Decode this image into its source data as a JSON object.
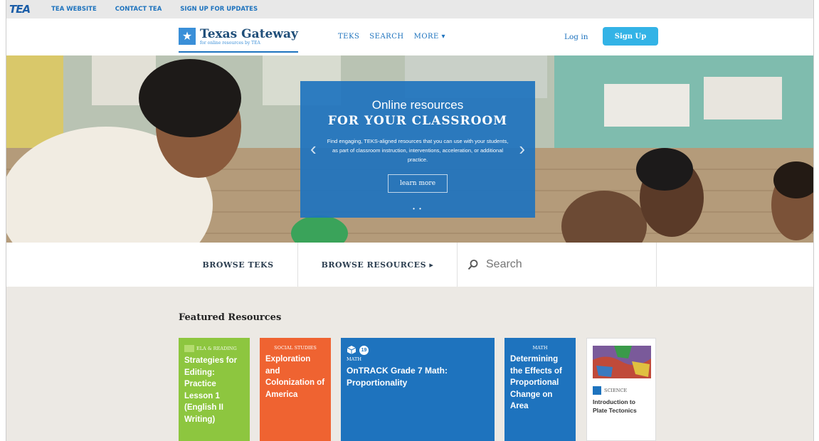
{
  "utility_bar": {
    "logo": "TEA",
    "links": [
      "TEA WEBSITE",
      "CONTACT TEA",
      "SIGN UP FOR UPDATES"
    ]
  },
  "header": {
    "brand_title": "Texas Gateway",
    "brand_subtitle": "for online resources by TEA",
    "nav": [
      "TEKS",
      "SEARCH",
      "MORE ▾"
    ],
    "login": "Log in",
    "signup": "Sign Up"
  },
  "hero": {
    "title_line1": "Online resources",
    "title_line2": "FOR YOUR CLASSROOM",
    "description": "Find engaging, TEKS-aligned resources that you can use with your students, as part of classroom instruction, interventions, acceleration, or additional practice.",
    "button": "learn more",
    "prev_arrow": "‹",
    "next_arrow": "›",
    "dots": "• •"
  },
  "browse": {
    "teks": "BROWSE TEKS",
    "resources": "BROWSE RESOURCES ▸",
    "search_placeholder": "Search"
  },
  "featured": {
    "title": "Featured Resources",
    "cards": [
      {
        "category": "ELA & READING",
        "title": "Strategies for Editing: Practice Lesson 1 (English II Writing)",
        "color": "#8dc63f"
      },
      {
        "category": "SOCIAL STUDIES",
        "title": "Exploration and Colonization of America",
        "color": "#ef6331"
      },
      {
        "category": "MATH",
        "badge": "19",
        "title": "OnTRACK Grade 7 Math: Proportionality",
        "color": "#1e73be"
      },
      {
        "category": "MATH",
        "title": "Determining the Effects of Proportional Change on Area",
        "color": "#1e73be"
      },
      {
        "category": "SCIENCE",
        "title": "Introduction to Plate Tectonics",
        "color": "#ffffff"
      }
    ]
  },
  "icons": {
    "brand": "star-icon",
    "search": "search-icon",
    "card3": "cube-icon",
    "card5": "book-icon"
  }
}
